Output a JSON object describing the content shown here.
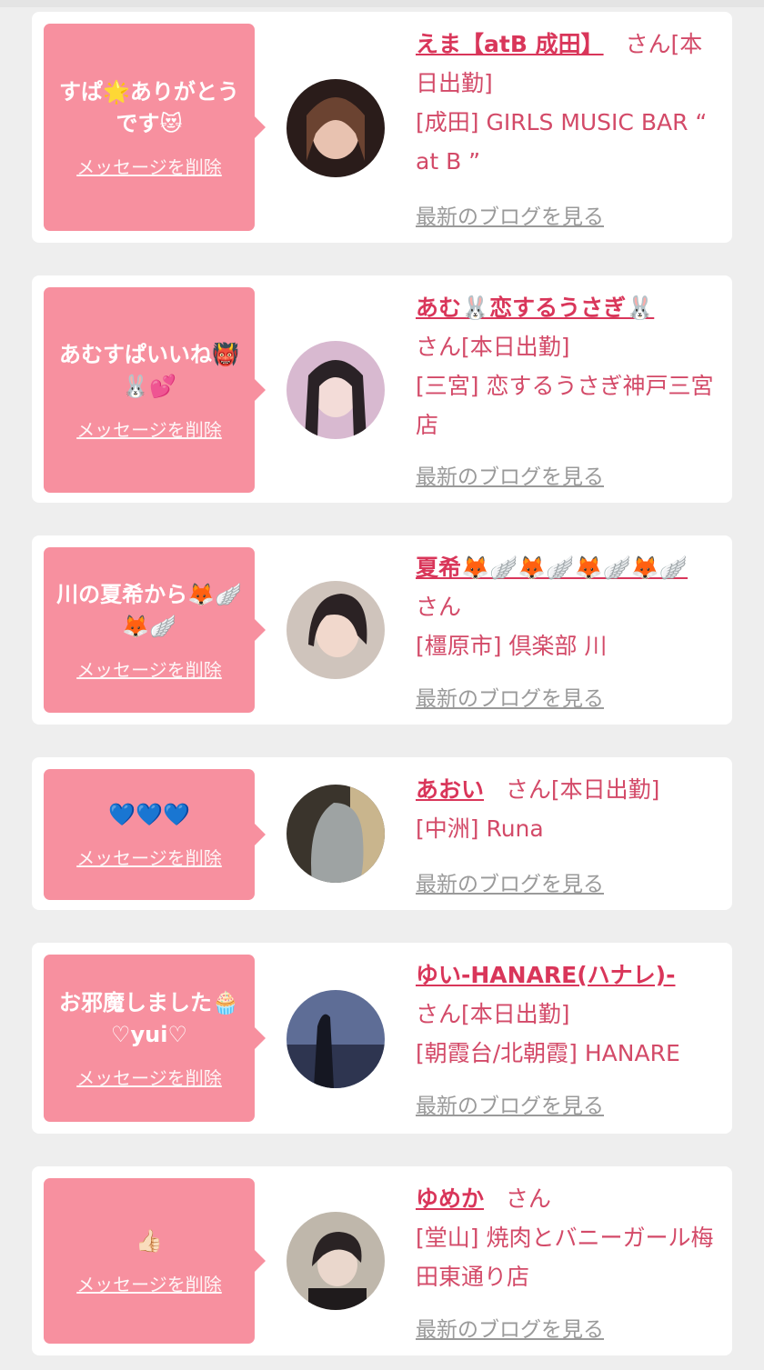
{
  "accent_color": "#f7909f",
  "name_color": "#d9365a",
  "link_color": "#9a9a9a",
  "cards": [
    {
      "message": "すぱ🌟ありがとうです😻",
      "delete_label": "メッセージを削除",
      "name": "えま【atB 成田】",
      "suffix": "さん[本日出勤]",
      "shop": "[成田] GIRLS MUSIC BAR “ at B ”",
      "blog_label": "最新のブログを見る"
    },
    {
      "message": "あむすぱいいね👹🐰💕",
      "delete_label": "メッセージを削除",
      "name": "あむ🐰恋するうさぎ🐰",
      "suffix": "さん[本日出勤]",
      "shop": "[三宮] 恋するうさぎ神戸三宮店",
      "blog_label": "最新のブログを見る"
    },
    {
      "message": "川の夏希から🦊🪽🦊🪽",
      "delete_label": "メッセージを削除",
      "name": "夏希🦊🪽🦊🪽🦊🪽🦊🪽",
      "suffix": "さん",
      "shop": "[橿原市] 倶楽部 川",
      "blog_label": "最新のブログを見る"
    },
    {
      "message": "💙💙💙",
      "delete_label": "メッセージを削除",
      "name": "あおい",
      "suffix": "さん[本日出勤]",
      "shop": "[中洲] Runa",
      "blog_label": "最新のブログを見る"
    },
    {
      "message": "お邪魔しました🧁♡yui♡",
      "delete_label": "メッセージを削除",
      "name": "ゆい-HANARE(ハナレ)-",
      "suffix": "さん[本日出勤]",
      "shop": "[朝霞台/北朝霞] HANARE",
      "blog_label": "最新のブログを見る"
    },
    {
      "message": "👍🏻",
      "delete_label": "メッセージを削除",
      "name": "ゆめか",
      "suffix": "さん",
      "shop": "[堂山] 焼肉とバニーガール梅田東通り店",
      "blog_label": "最新のブログを見る"
    }
  ]
}
